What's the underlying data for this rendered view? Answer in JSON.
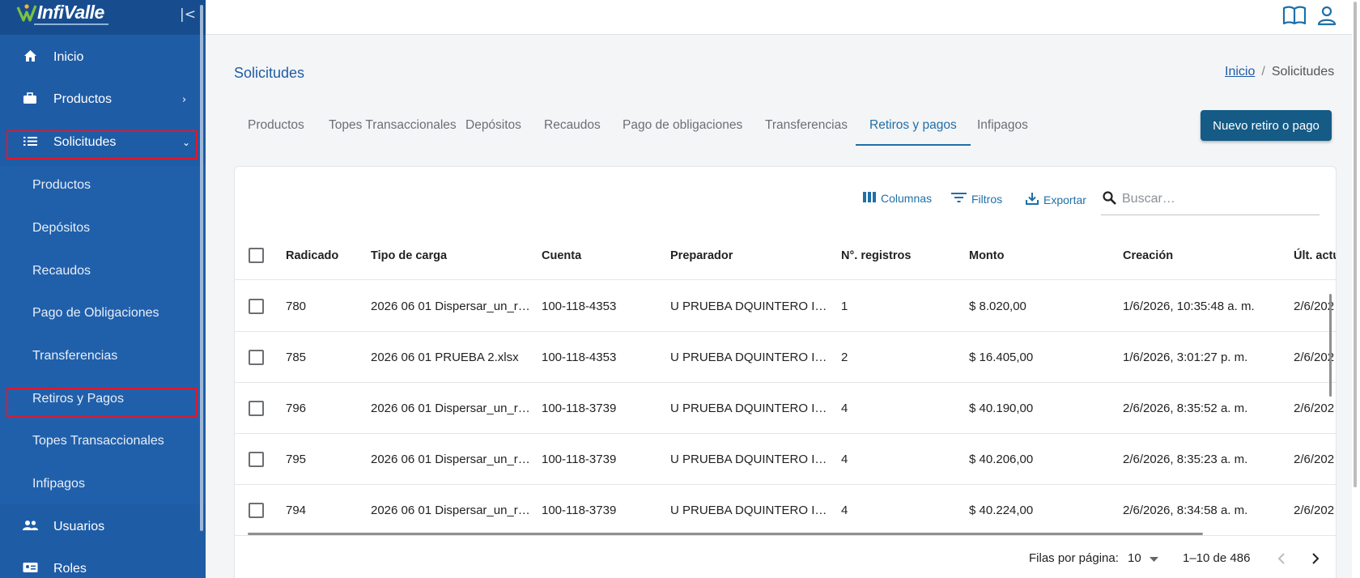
{
  "app": {
    "logo": "InfiValle"
  },
  "sidebar": {
    "items": [
      {
        "label": "Inicio",
        "icon": "home-icon"
      },
      {
        "label": "Productos",
        "icon": "briefcase-icon"
      },
      {
        "label": "Solicitudes",
        "icon": "list-icon"
      }
    ],
    "subitems": [
      {
        "label": "Productos"
      },
      {
        "label": "Depósitos"
      },
      {
        "label": "Recaudos"
      },
      {
        "label": "Pago de Obligaciones"
      },
      {
        "label": "Transferencias"
      },
      {
        "label": "Retiros y Pagos"
      },
      {
        "label": "Topes Transaccionales"
      },
      {
        "label": "Infipagos"
      }
    ],
    "bottom_items": [
      {
        "label": "Usuarios",
        "icon": "users-icon"
      },
      {
        "label": "Roles",
        "icon": "id-card-icon"
      }
    ]
  },
  "header": {
    "title": "Solicitudes",
    "breadcrumb_home": "Inicio",
    "breadcrumb_current": "Solicitudes"
  },
  "tabs": [
    {
      "label": "Productos"
    },
    {
      "label": "Topes Transaccionales"
    },
    {
      "label": "Depósitos"
    },
    {
      "label": "Recaudos"
    },
    {
      "label": "Pago de obligaciones"
    },
    {
      "label": "Transferencias"
    },
    {
      "label": "Retiros y pagos",
      "active": true
    },
    {
      "label": "Infipagos"
    }
  ],
  "actions": {
    "new_button": "Nuevo retiro o pago"
  },
  "toolbar": {
    "columns": "Columnas",
    "filters": "Filtros",
    "export": "Exportar",
    "search_placeholder": "Buscar…"
  },
  "table": {
    "columns": [
      "Radicado",
      "Tipo de carga",
      "Cuenta",
      "Preparador",
      "N°. registros",
      "Monto",
      "Creación",
      "Últ. actu"
    ],
    "rows": [
      [
        "780",
        "2026 06 01 Dispersar_un_r…",
        "100-118-4353",
        "U PRUEBA DQUINTERO I…",
        "1",
        "$ 8.020,00",
        "1/6/2026, 10:35:48 a. m.",
        "2/6/202"
      ],
      [
        "785",
        "2026 06 01 PRUEBA 2.xlsx",
        "100-118-4353",
        "U PRUEBA DQUINTERO I…",
        "2",
        "$ 16.405,00",
        "1/6/2026, 3:01:27 p. m.",
        "2/6/202"
      ],
      [
        "796",
        "2026 06 01 Dispersar_un_r…",
        "100-118-3739",
        "U PRUEBA DQUINTERO I…",
        "4",
        "$ 40.190,00",
        "2/6/2026, 8:35:52 a. m.",
        "2/6/202"
      ],
      [
        "795",
        "2026 06 01 Dispersar_un_r…",
        "100-118-3739",
        "U PRUEBA DQUINTERO I…",
        "4",
        "$ 40.206,00",
        "2/6/2026, 8:35:23 a. m.",
        "2/6/202"
      ],
      [
        "794",
        "2026 06 01 Dispersar_un_r…",
        "100-118-3739",
        "U PRUEBA DQUINTERO I…",
        "4",
        "$ 40.224,00",
        "2/6/2026, 8:34:58 a. m.",
        "2/6/202"
      ]
    ]
  },
  "pagination": {
    "rows_per_page_label": "Filas por página:",
    "rows_per_page": "10",
    "range": "1–10 de 486"
  },
  "colors": {
    "sidebar": "#1f5ca6",
    "accent": "#1f6fa8",
    "button": "#155b86",
    "highlight": "#e0182b"
  }
}
